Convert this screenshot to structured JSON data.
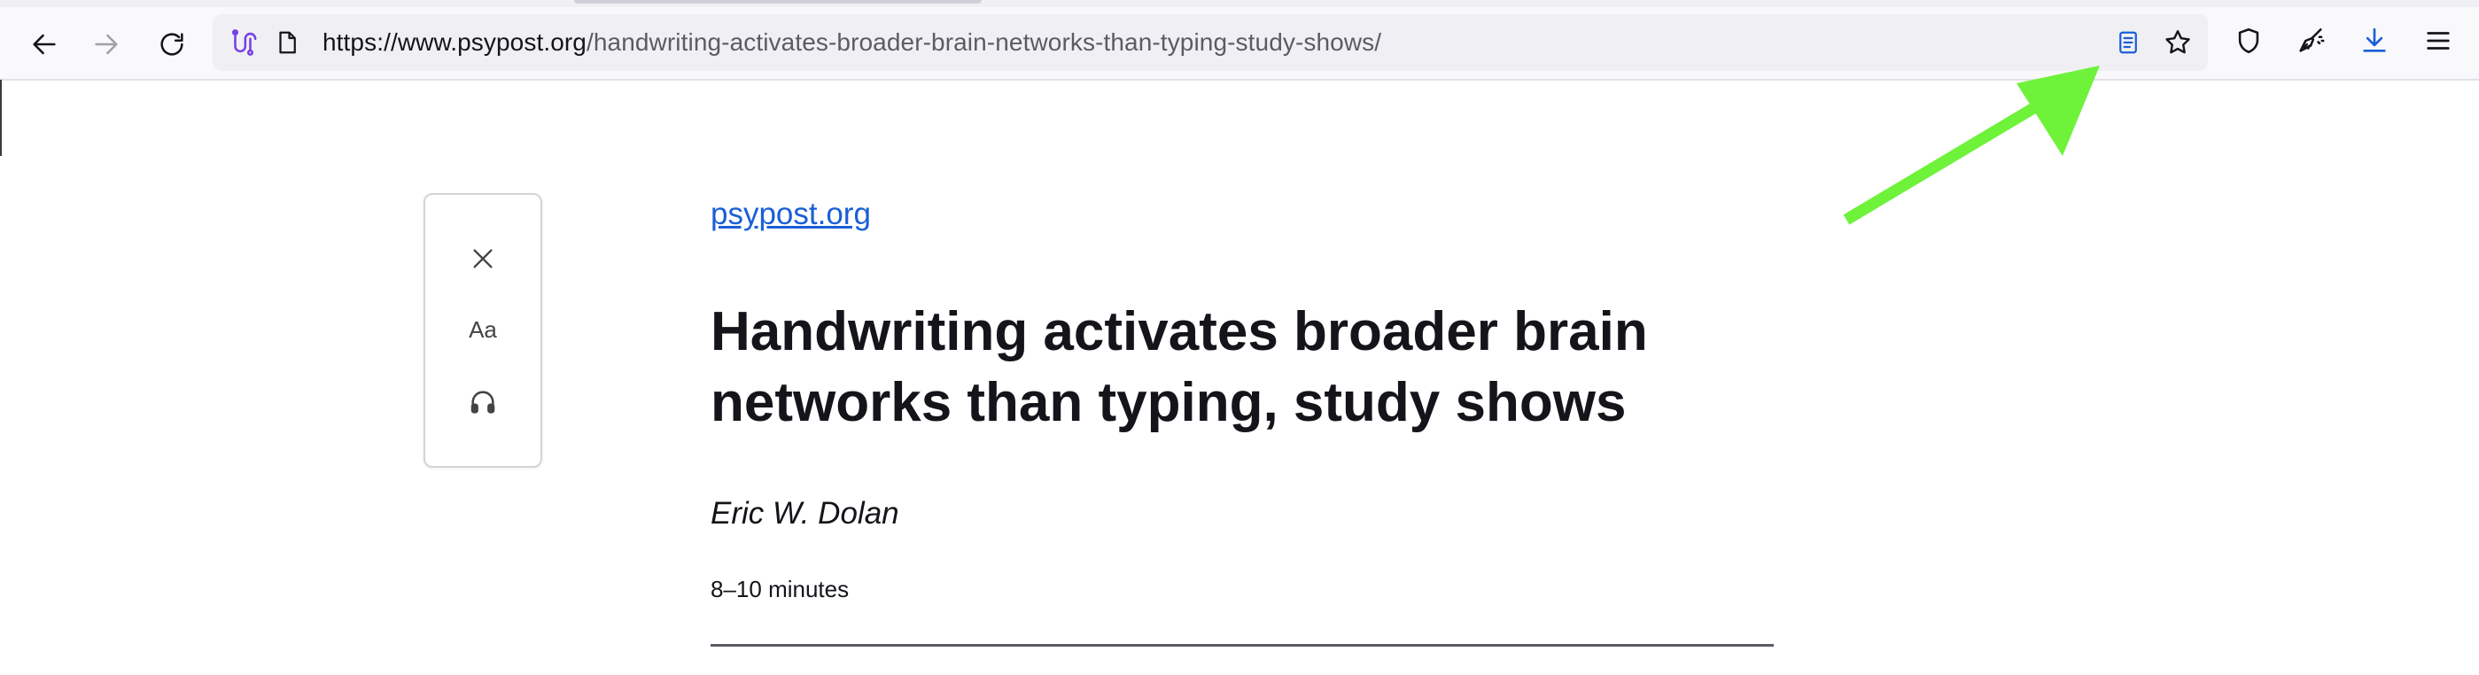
{
  "toolbar": {
    "url_host": "https://www.psypost.org",
    "url_path": "/handwriting-activates-broader-brain-networks-than-typing-study-shows/"
  },
  "icons": {
    "back": "arrow-left-icon",
    "forward": "arrow-right-icon",
    "reload": "reload-icon",
    "extension": "extension-icon",
    "page": "page-icon",
    "reader_view": "reader-view-icon",
    "bookmark": "star-icon",
    "tracking": "shield-icon",
    "cleaner": "broom-icon",
    "downloads": "download-icon",
    "menu": "hamburger-icon"
  },
  "reader_toolbar": {
    "type_controls_label": "Aa"
  },
  "article": {
    "site": "psypost.org",
    "title": "Handwriting activates broader brain networks than typing, study shows",
    "author": "Eric W. Dolan",
    "reading_time": "8–10 minutes"
  },
  "colors": {
    "accent": "#1a5fd6",
    "annotation_arrow": "#6ef23a"
  }
}
